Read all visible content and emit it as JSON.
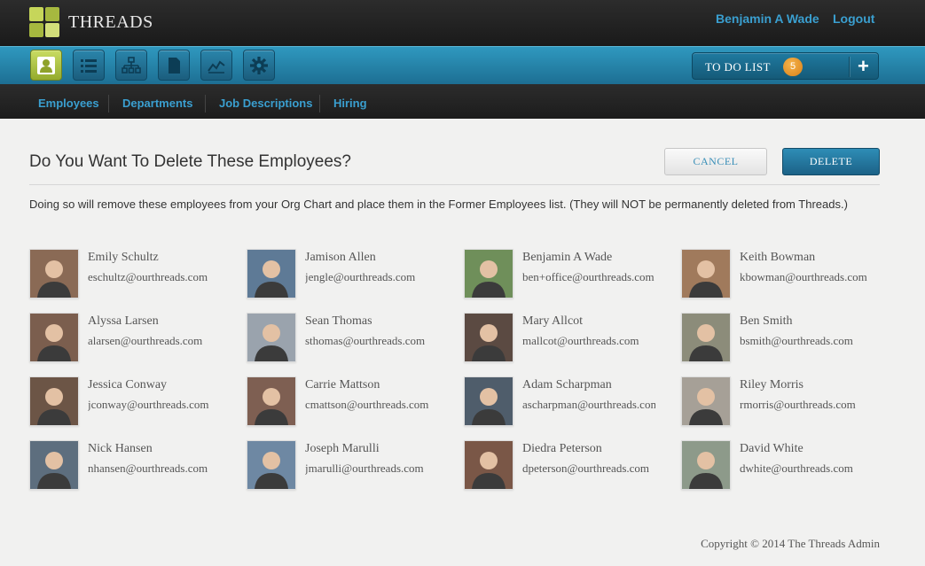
{
  "app": {
    "name": "THREADS",
    "user_name": "Benjamin A Wade",
    "logout_label": "Logout"
  },
  "toolbar": {
    "icons": [
      "person-icon",
      "list-icon",
      "org-chart-icon",
      "document-icon",
      "chart-icon",
      "gear-icon"
    ],
    "todo_label": "TO DO LIST",
    "todo_count": "5",
    "add_symbol": "+"
  },
  "subnav": {
    "items": [
      "Employees",
      "Departments",
      "Job Descriptions",
      "Hiring"
    ]
  },
  "dialog": {
    "title": "Do You Want To Delete These Employees?",
    "cancel_label": "CANCEL",
    "delete_label": "DELETE",
    "description": "Doing so will remove these employees from your Org Chart and place them in the Former Employees list. (They will NOT be permanently deleted from Threads.)"
  },
  "employees": [
    {
      "name": "Emily Schultz",
      "email": "eschultz@ourthreads.com"
    },
    {
      "name": "Jamison Allen",
      "email": "jengle@ourthreads.com"
    },
    {
      "name": "Benjamin A Wade",
      "email": "ben+office@ourthreads.com"
    },
    {
      "name": "Keith Bowman",
      "email": "kbowman@ourthreads.com"
    },
    {
      "name": "Alyssa Larsen",
      "email": "alarsen@ourthreads.com"
    },
    {
      "name": "Sean Thomas",
      "email": "sthomas@ourthreads.com"
    },
    {
      "name": "Mary Allcot",
      "email": "mallcot@ourthreads.com"
    },
    {
      "name": "Ben Smith",
      "email": "bsmith@ourthreads.com"
    },
    {
      "name": "Jessica Conway",
      "email": "jconway@ourthreads.com"
    },
    {
      "name": "Carrie Mattson",
      "email": "cmattson@ourthreads.com"
    },
    {
      "name": "Adam Scharpman",
      "email": "ascharpman@ourthreads.com"
    },
    {
      "name": "Riley Morris",
      "email": "rmorris@ourthreads.com"
    },
    {
      "name": "Nick Hansen",
      "email": "nhansen@ourthreads.com"
    },
    {
      "name": "Joseph Marulli",
      "email": "jmarulli@ourthreads.com"
    },
    {
      "name": "Diedra Peterson",
      "email": "dpeterson@ourthreads.com"
    },
    {
      "name": "David White",
      "email": "dwhite@ourthreads.com"
    }
  ],
  "footer": {
    "copyright": "Copyright © 2014 The Threads Admin"
  },
  "colors": {
    "accent_blue": "#2e8db6",
    "link_blue": "#3a9fd0",
    "active_green": "#b7c94a",
    "badge_orange": "#e8921f"
  }
}
